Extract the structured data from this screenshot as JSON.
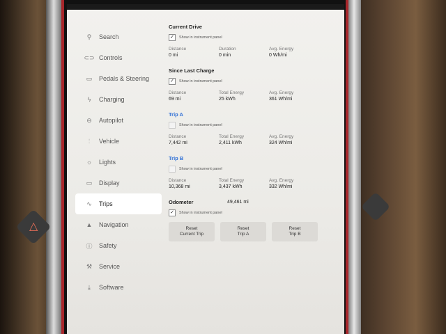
{
  "sidebar": {
    "items": [
      {
        "label": "Search",
        "icon": "search-icon"
      },
      {
        "label": "Controls",
        "icon": "toggle-icon"
      },
      {
        "label": "Pedals & Steering",
        "icon": "car-icon"
      },
      {
        "label": "Charging",
        "icon": "bolt-icon"
      },
      {
        "label": "Autopilot",
        "icon": "steering-wheel-icon"
      },
      {
        "label": "Vehicle",
        "icon": "sliders-icon"
      },
      {
        "label": "Lights",
        "icon": "sun-icon"
      },
      {
        "label": "Display",
        "icon": "display-icon"
      },
      {
        "label": "Trips",
        "icon": "route-icon",
        "active": true
      },
      {
        "label": "Navigation",
        "icon": "navigation-arrow-icon"
      },
      {
        "label": "Safety",
        "icon": "info-circle-icon"
      },
      {
        "label": "Service",
        "icon": "wrench-icon"
      },
      {
        "label": "Software",
        "icon": "download-icon"
      }
    ]
  },
  "current_drive": {
    "title": "Current Drive",
    "show_label": "Show in instrument panel",
    "checked": true,
    "distance_label": "Distance",
    "distance": "0 mi",
    "duration_label": "Duration",
    "duration": "0 min",
    "avg_label": "Avg. Energy",
    "avg": "0 Wh/mi"
  },
  "since_last_charge": {
    "title": "Since Last Charge",
    "show_label": "Show in instrument panel",
    "checked": true,
    "distance_label": "Distance",
    "distance": "69 mi",
    "energy_label": "Total Energy",
    "energy": "25 kWh",
    "avg_label": "Avg. Energy",
    "avg": "361 Wh/mi"
  },
  "trip_a": {
    "title": "Trip A",
    "show_label": "Show in instrument panel",
    "checked": false,
    "distance_label": "Distance",
    "distance": "7,442 mi",
    "energy_label": "Total Energy",
    "energy": "2,411 kWh",
    "avg_label": "Avg. Energy",
    "avg": "324 Wh/mi"
  },
  "trip_b": {
    "title": "Trip B",
    "show_label": "Show in instrument panel",
    "checked": false,
    "distance_label": "Distance",
    "distance": "10,368 mi",
    "energy_label": "Total Energy",
    "energy": "3,437 kWh",
    "avg_label": "Avg. Energy",
    "avg": "332 Wh/mi"
  },
  "odometer": {
    "label": "Odometer",
    "value": "49,461 mi",
    "show_label": "Show in instrument panel",
    "checked": true
  },
  "buttons": {
    "reset_current": "Reset\nCurrent Trip",
    "reset_a": "Reset\nTrip A",
    "reset_b": "Reset\nTrip B"
  },
  "colors": {
    "accent_blue": "#2f6fd6",
    "frame_red": "#a8262b"
  }
}
